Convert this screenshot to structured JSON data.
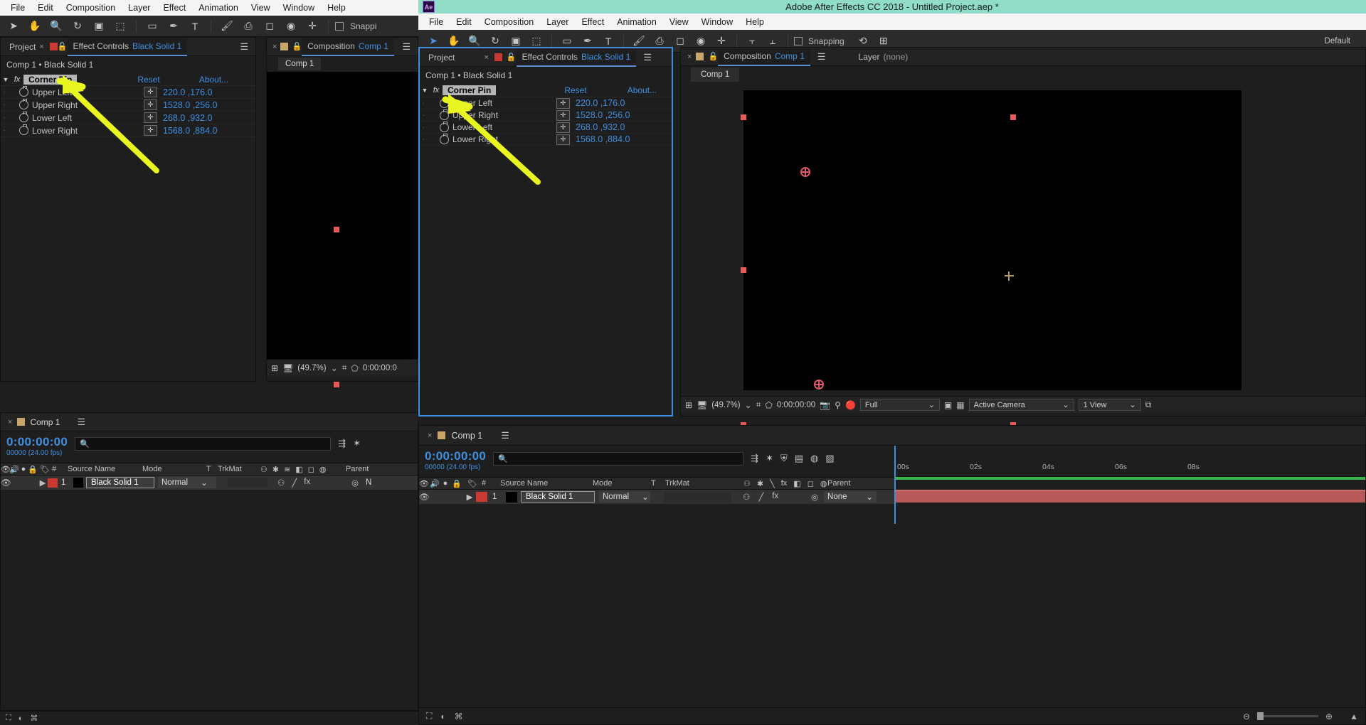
{
  "back_window": {
    "menubar": [
      "File",
      "Edit",
      "Composition",
      "Layer",
      "Effect",
      "Animation",
      "View",
      "Window",
      "Help"
    ],
    "snapping_label": "Snappi",
    "project_panel": {
      "tab_project": "Project",
      "close_x": "×",
      "tab_effect_controls": "Effect Controls",
      "tab_effect_target": "Black Solid 1",
      "menu_icon": "hamburger-icon",
      "breadcrumb": "Comp 1 • Black Solid 1"
    },
    "effect_controls": {
      "effect_name": "Corner Pin",
      "reset_label": "Reset",
      "about_label": "About...",
      "fx_label": "fx",
      "properties": [
        {
          "name": "Upper Left",
          "value": "220.0 ,176.0"
        },
        {
          "name": "Upper Right",
          "value": "1528.0 ,256.0"
        },
        {
          "name": "Lower Left",
          "value": "268.0 ,932.0"
        },
        {
          "name": "Lower Right",
          "value": "1568.0 ,884.0"
        }
      ]
    },
    "comp_panel": {
      "tab_composition": "Composition",
      "tab_comp_name": "Comp 1",
      "close_x": "×",
      "comp_tab": "Comp 1",
      "zoom_level": "(49.7%)",
      "timecode": "0:00:00:0"
    },
    "timeline": {
      "tab_name": "Comp 1",
      "close_x": "×",
      "timecode": "0:00:00:00",
      "frames": "00000 (24.00 fps)",
      "search_placeholder": "",
      "columns": [
        "#",
        "Source Name",
        "Mode",
        "T",
        "TrkMat",
        "Parent"
      ],
      "layer": {
        "index": "1",
        "source_name": "Black Solid 1",
        "mode": "Normal",
        "parent": "N"
      }
    }
  },
  "front_window": {
    "title": "Adobe After Effects CC 2018 - Untitled Project.aep *",
    "app_badge": "Ae",
    "menubar": [
      "File",
      "Edit",
      "Composition",
      "Layer",
      "Effect",
      "Animation",
      "View",
      "Window",
      "Help"
    ],
    "snapping_label": "Snapping",
    "workspace_label": "Default",
    "effect_controls": {
      "tab_project": "Project",
      "close_x": "×",
      "tab_effect_controls": "Effect Controls",
      "tab_effect_target": "Black Solid 1",
      "breadcrumb": "Comp 1 • Black Solid 1",
      "effect_name": "Corner Pin",
      "reset_label": "Reset",
      "about_label": "About...",
      "fx_label": "fx",
      "properties": [
        {
          "name": "Upper Left",
          "value": "220.0 ,176.0"
        },
        {
          "name": "Upper Right",
          "value": "1528.0 ,256.0"
        },
        {
          "name": "Lower Left",
          "value": "268.0 ,932.0"
        },
        {
          "name": "Lower Right",
          "value": "1568.0 ,884.0"
        }
      ]
    },
    "comp_panel": {
      "close_x": "×",
      "tab_composition": "Composition",
      "tab_comp_name": "Comp 1",
      "layer_tab": "Layer",
      "layer_tab_value": "(none)",
      "comp_tab": "Comp 1",
      "zoom_level": "(49.7%)",
      "timecode": "0:00:00:00",
      "resolution": "Full",
      "camera": "Active Camera",
      "views": "1 View"
    },
    "timeline": {
      "close_x": "×",
      "tab_name": "Comp 1",
      "timecode": "0:00:00:00",
      "frames": "00000 (24.00 fps)",
      "search_placeholder": "",
      "columns": [
        "#",
        "Source Name",
        "Mode",
        "T",
        "TrkMat",
        "Parent"
      ],
      "layer": {
        "index": "1",
        "source_name": "Black Solid 1",
        "mode": "Normal",
        "parent": "None"
      },
      "ruler_ticks": [
        "00s",
        "02s",
        "04s",
        "06s",
        "08s"
      ]
    }
  },
  "colors": {
    "titlebar": "#8fdcc8",
    "accent_blue": "#3f8fe0",
    "annotation_yellow": "#e8f520",
    "layer_bar_red": "#b85a5a",
    "handle_red": "#e85a5a"
  }
}
